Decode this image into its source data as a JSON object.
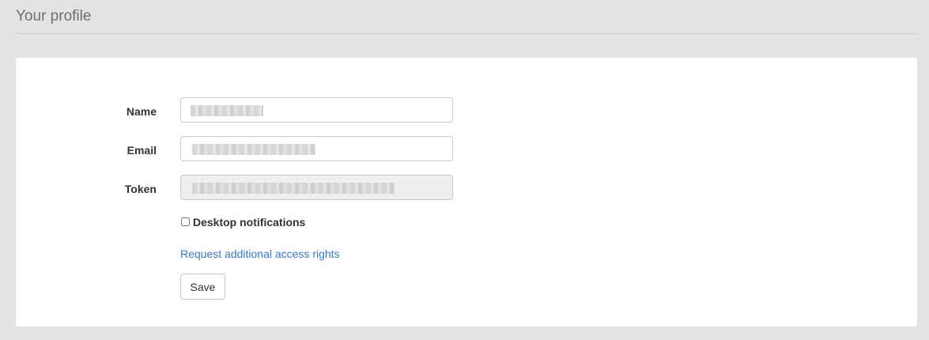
{
  "page": {
    "title": "Your profile"
  },
  "form": {
    "name": {
      "label": "Name",
      "value": "",
      "redacted": true
    },
    "email": {
      "label": "Email",
      "value": "",
      "redacted": true
    },
    "token": {
      "label": "Token",
      "value": "",
      "redacted": true,
      "readonly": true
    },
    "desktop_notifications": {
      "label": "Desktop notifications",
      "checked": false
    },
    "request_link": "Request additional access rights",
    "save_label": "Save"
  },
  "colors": {
    "background": "#e3e3e3",
    "card": "#ffffff",
    "link": "#3a78c3",
    "readonly_field": "#eeeeee"
  }
}
